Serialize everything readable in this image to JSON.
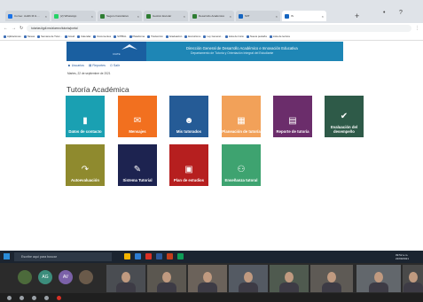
{
  "browser": {
    "tabs": [
      {
        "label": "Correo: Judith M.G ...",
        "color": "#1a73e8"
      },
      {
        "label": "(2) WhatsApp",
        "color": "#25d366"
      },
      {
        "label": "Seguro Facultativo",
        "color": "#2e7d32"
      },
      {
        "label": "Gestión Escolar",
        "color": "#2e7d32"
      },
      {
        "label": "Desarrollo Académico",
        "color": "#2e7d32"
      },
      {
        "label": "SIIT",
        "color": "#1565c0"
      },
      {
        "label": "IS",
        "color": "#1565c0"
      }
    ],
    "url": "tutorias.itgdl.mx/alumno/tutoria/portal"
  },
  "bookmarks": [
    "Aplicaciones",
    "Tareas",
    "Semana de Tutor...",
    "Gmail",
    "Calendar",
    "Documentos",
    "SIITBAL",
    "Plataforma",
    "Traducción",
    "Graduación",
    "Ecoturismo",
    "Ley General...",
    "Lista de Inicio",
    "Nueva pestaña",
    "Lista de lectura"
  ],
  "header": {
    "logo_text": "CIATE",
    "title": "Dirección General de Desarrollo Académico e Innovación Educativa",
    "subtitle": "Departamento de Tutoría y Orientación Integral del Estudiante"
  },
  "nav": {
    "items": [
      "Usuarios",
      "Reportes",
      "Salir"
    ]
  },
  "date": "Martes, 22 de septiembre de 2021",
  "page": {
    "heading": "Tutoría Académica"
  },
  "tiles": [
    {
      "label": "Datos de contacto",
      "color": "#1aa0b2",
      "icon": "notebook-icon"
    },
    {
      "label": "Mensajes",
      "color": "#f2701f",
      "icon": "envelope-icon"
    },
    {
      "label": "Mis tutorados",
      "color": "#255b96",
      "icon": "people-icon"
    },
    {
      "label": "Planeación de tutoría",
      "color": "#f2a159",
      "icon": "calendar-icon"
    },
    {
      "label": "Reporte de tutoría",
      "color": "#6b2d6b",
      "icon": "clipboard-icon"
    },
    {
      "label": "Evaluación del desempeño",
      "color": "#2e5a48",
      "icon": "checkmark-icon"
    },
    {
      "label": "Autoevaluación",
      "color": "#8f8a2e",
      "icon": "arrow-icon"
    },
    {
      "label": "Sistema Tutorial",
      "color": "#1d2350",
      "icon": "wrench-icon"
    },
    {
      "label": "Plan de estudios",
      "color": "#b61f1f",
      "icon": "document-icon"
    },
    {
      "label": "Enseñanza tutoral",
      "color": "#3ea370",
      "icon": "teacher-icon"
    }
  ],
  "taskbar": {
    "search_placeholder": "Escribe aquí para buscar",
    "time": "09:52 a.m.",
    "date": "22/09/2021"
  },
  "meeting": {
    "avatars": [
      "AG",
      "AV"
    ]
  }
}
